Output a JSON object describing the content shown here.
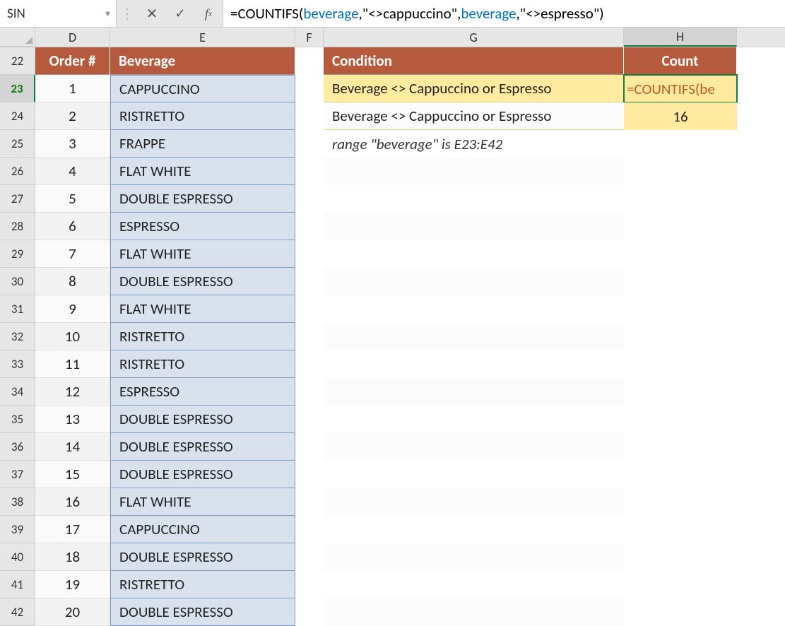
{
  "nameBox": "SIN",
  "formulaBar": {
    "prefix": "=COUNTIFS(",
    "ref1": "beverage",
    "mid1": ",\"<>cappuccino\",",
    "ref2": "beverage",
    "suffix": ",\"<>espresso\")"
  },
  "columns": {
    "D": "D",
    "E": "E",
    "F": "F",
    "G": "G",
    "H": "H"
  },
  "headers": {
    "order": "Order #",
    "beverage": "Beverage",
    "condition": "Condition",
    "count": "Count"
  },
  "rows": [
    {
      "n": 22,
      "order": "",
      "bev": "",
      "g": "",
      "h": ""
    },
    {
      "n": 23,
      "order": "1",
      "bev": "CAPPUCCINO",
      "g": "Beverage <> Cappuccino or Espresso",
      "h": "=COUNTIFS(be"
    },
    {
      "n": 24,
      "order": "2",
      "bev": "RISTRETTO",
      "g": "Beverage <> Cappuccino or Espresso",
      "h": "16"
    },
    {
      "n": 25,
      "order": "3",
      "bev": "FRAPPE",
      "g": "range \"beverage\" is E23:E42",
      "h": ""
    },
    {
      "n": 26,
      "order": "4",
      "bev": "FLAT WHITE",
      "g": "",
      "h": ""
    },
    {
      "n": 27,
      "order": "5",
      "bev": "DOUBLE ESPRESSO",
      "g": "",
      "h": ""
    },
    {
      "n": 28,
      "order": "6",
      "bev": "ESPRESSO",
      "g": "",
      "h": ""
    },
    {
      "n": 29,
      "order": "7",
      "bev": "FLAT WHITE",
      "g": "",
      "h": ""
    },
    {
      "n": 30,
      "order": "8",
      "bev": "DOUBLE ESPRESSO",
      "g": "",
      "h": ""
    },
    {
      "n": 31,
      "order": "9",
      "bev": "FLAT WHITE",
      "g": "",
      "h": ""
    },
    {
      "n": 32,
      "order": "10",
      "bev": "RISTRETTO",
      "g": "",
      "h": ""
    },
    {
      "n": 33,
      "order": "11",
      "bev": "RISTRETTO",
      "g": "",
      "h": ""
    },
    {
      "n": 34,
      "order": "12",
      "bev": "ESPRESSO",
      "g": "",
      "h": ""
    },
    {
      "n": 35,
      "order": "13",
      "bev": "DOUBLE ESPRESSO",
      "g": "",
      "h": ""
    },
    {
      "n": 36,
      "order": "14",
      "bev": "DOUBLE ESPRESSO",
      "g": "",
      "h": ""
    },
    {
      "n": 37,
      "order": "15",
      "bev": "DOUBLE ESPRESSO",
      "g": "",
      "h": ""
    },
    {
      "n": 38,
      "order": "16",
      "bev": "FLAT WHITE",
      "g": "",
      "h": ""
    },
    {
      "n": 39,
      "order": "17",
      "bev": "CAPPUCCINO",
      "g": "",
      "h": ""
    },
    {
      "n": 40,
      "order": "18",
      "bev": "DOUBLE ESPRESSO",
      "g": "",
      "h": ""
    },
    {
      "n": 41,
      "order": "19",
      "bev": "RISTRETTO",
      "g": "",
      "h": ""
    },
    {
      "n": 42,
      "order": "20",
      "bev": "DOUBLE ESPRESSO",
      "g": "",
      "h": ""
    }
  ]
}
